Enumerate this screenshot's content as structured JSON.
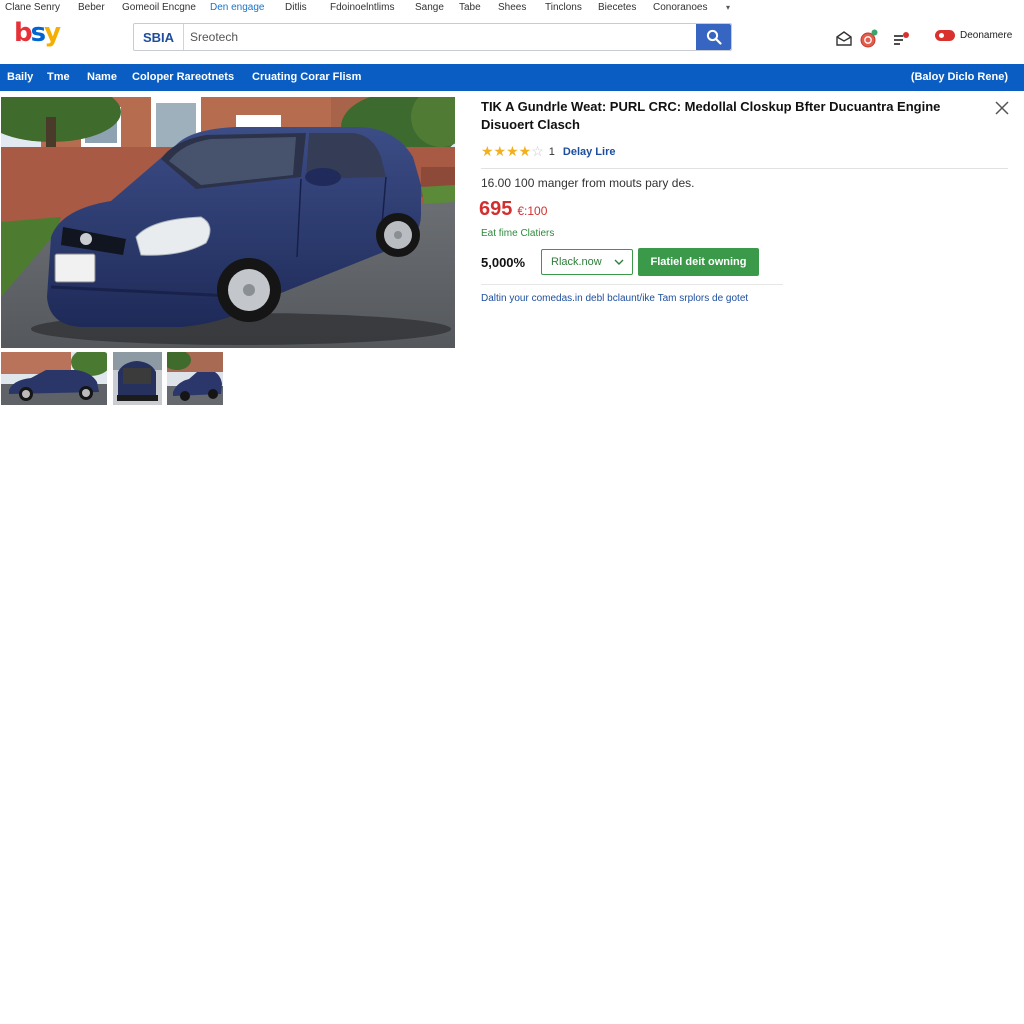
{
  "top_links": [
    {
      "label": "Clane Senry",
      "active": false
    },
    {
      "label": "Beber",
      "active": false
    },
    {
      "label": "Gomeoil Encgne",
      "active": false
    },
    {
      "label": "Den engage",
      "active": true
    },
    {
      "label": "Ditlis",
      "active": false
    },
    {
      "label": "Fdoinoelntlims",
      "active": false
    },
    {
      "label": "Sange",
      "active": false
    },
    {
      "label": "Tabe",
      "active": false
    },
    {
      "label": "Shees",
      "active": false
    },
    {
      "label": "Tinclons",
      "active": false
    },
    {
      "label": "Biecetes",
      "active": false
    },
    {
      "label": "Conoranoes",
      "active": false
    }
  ],
  "header": {
    "logo": {
      "l1": "b",
      "l2": "s",
      "l3": "y",
      "l4": ""
    },
    "search_category": "SBIA",
    "search_placeholder": "Sreotech",
    "account_label": "Deonamere"
  },
  "nav": {
    "items": [
      "Baily",
      "Tme",
      "Name",
      "Coloper Rareotnets",
      "Cruating Corar Flism"
    ],
    "right_label": "(Baloy Diclo Rene)"
  },
  "listing": {
    "title": "TIK A Gundrle Weat: PURL CRC: Medollal Closkup Bfter Ducuantra Engine Disuoert Clasch",
    "rating_value": 4.5,
    "rating_max": 5,
    "rating_count": "1",
    "rating_link": "Delay Lire",
    "subtitle": "16.00 100 manger from mouts pary des.",
    "price": "695",
    "price_secondary": "€:100",
    "shipping": "Eat fime Clatiers",
    "quantity": "5,000%",
    "select_value": "Rlack.now",
    "buy_button": "Flatiel deit owning",
    "note": "Daltin your comedas.in debl bclaunt/ike Tam srplors de gotet"
  },
  "colors": {
    "nav_blue": "#0a5dc2",
    "search_button": "#3665c2",
    "price_red": "#d32f2f",
    "buy_green": "#3a9a4a",
    "link_blue": "#1d4e9e",
    "star_gold": "#f2b01e"
  },
  "icons": [
    "search-icon",
    "mail-icon",
    "notification-icon",
    "cart-icon",
    "close-icon",
    "chevron-down-icon"
  ]
}
